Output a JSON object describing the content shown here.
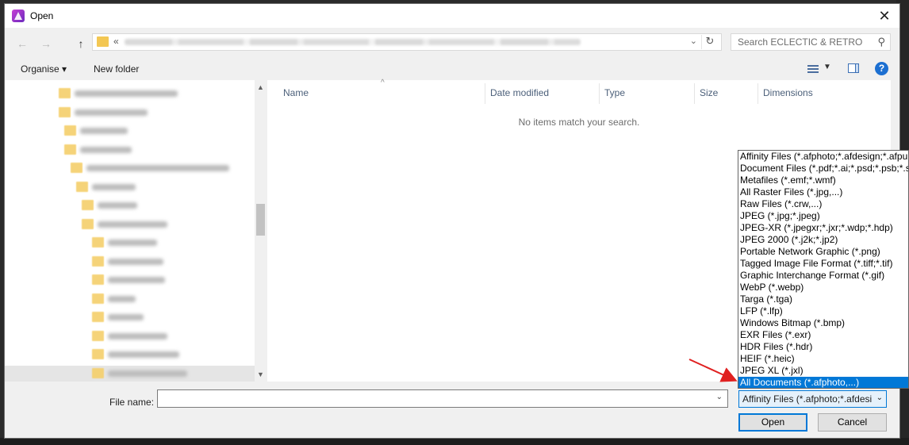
{
  "window": {
    "title": "Open",
    "close_glyph": "✕"
  },
  "address": {
    "back_glyph": "←",
    "forward_glyph": "→",
    "up_glyph": "↑",
    "prefix": "«",
    "dropdown_glyph": "⌄",
    "refresh_glyph": "↻",
    "search_placeholder": "Search ECLECTIC & RETRO"
  },
  "toolbar": {
    "organise_label": "Organise ▾",
    "new_folder_label": "New folder",
    "help_glyph": "?",
    "view_drop_glyph": "▼"
  },
  "list": {
    "columns": [
      "Name",
      "Date modified",
      "Type",
      "Size",
      "Dimensions"
    ],
    "sort_glyph": "^",
    "empty_message": "No items match your search."
  },
  "footer": {
    "file_name_label": "File name:",
    "file_name_value": "",
    "file_type_selected": "Affinity Files (*.afphoto;*.afdesi",
    "open_label": "Open",
    "cancel_label": "Cancel",
    "drop_glyph": "⌄"
  },
  "file_types": [
    "Affinity Files (*.afphoto;*.afdesign;*.afpub",
    "Document Files (*.pdf;*.ai;*.psd;*.psb;*.sv",
    "Metafiles (*.emf;*.wmf)",
    "All Raster Files (*.jpg,...)",
    "Raw Files (*.crw,...)",
    "JPEG (*.jpg;*.jpeg)",
    "JPEG-XR (*.jpegxr;*.jxr;*.wdp;*.hdp)",
    "JPEG 2000 (*.j2k;*.jp2)",
    "Portable Network Graphic (*.png)",
    "Tagged Image File Format (*.tiff;*.tif)",
    "Graphic Interchange Format (*.gif)",
    "WebP (*.webp)",
    "Targa (*.tga)",
    "LFP (*.lfp)",
    "Windows Bitmap (*.bmp)",
    "EXR Files (*.exr)",
    "HDR Files (*.hdr)",
    "HEIF (*.heic)",
    "JPEG XL (*.jxl)",
    "All Documents (*.afphoto,...)"
  ],
  "selected_file_type_index": 19,
  "colors": {
    "accent": "#0078d7",
    "arrow": "#e02020",
    "folder": "#f3c753"
  }
}
